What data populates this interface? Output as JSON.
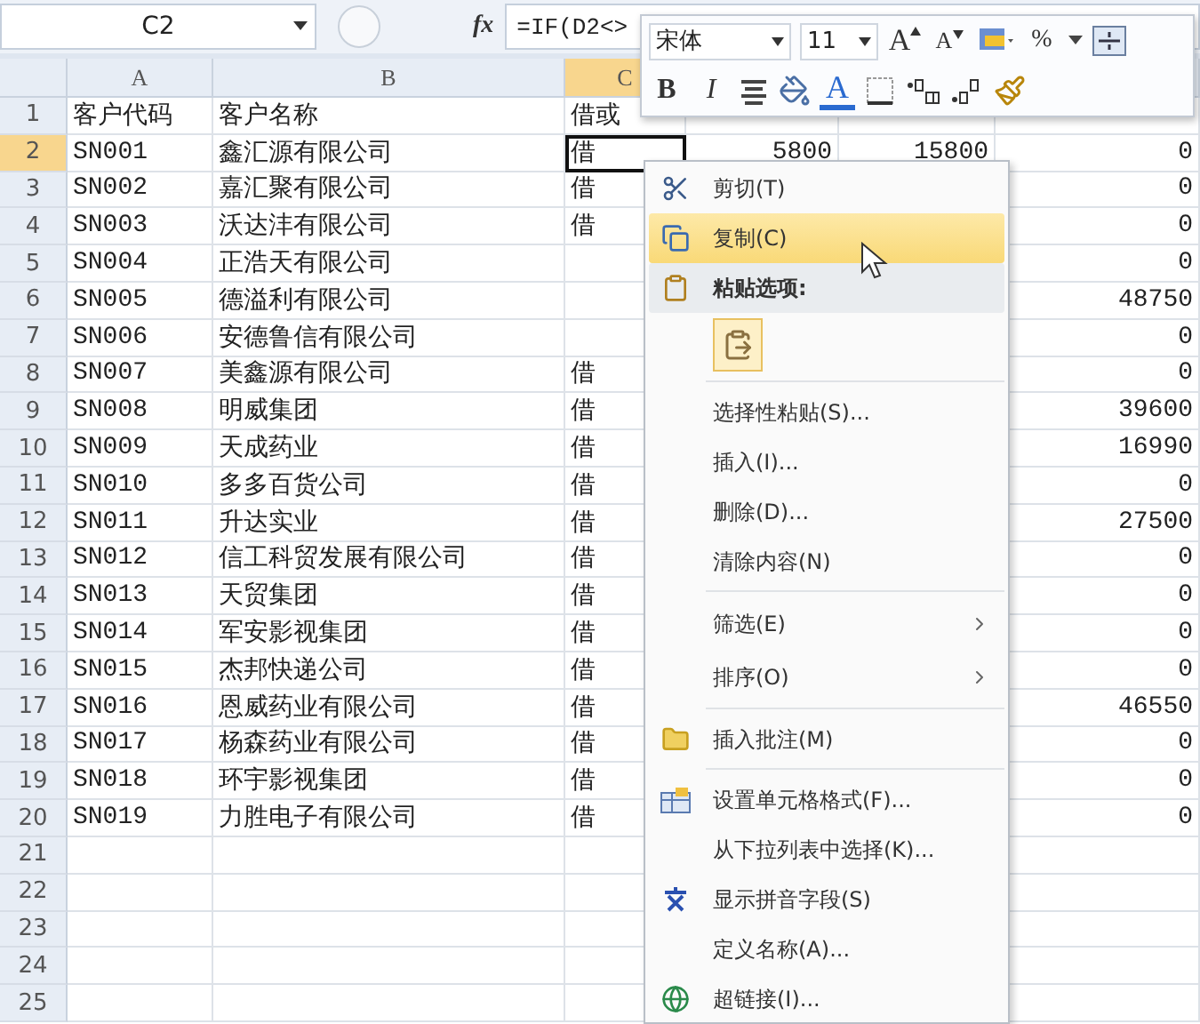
{
  "formula_bar": {
    "name_box": "C2",
    "function_label": "fx",
    "formula": "=IF(D2<>"
  },
  "mini_toolbar": {
    "rows": [
      [
        {
          "kind": "font",
          "value": "宋体"
        },
        {
          "kind": "size",
          "value": "11"
        },
        {
          "kind": "grow",
          "label": "A"
        },
        {
          "kind": "shrink",
          "label": "A"
        },
        {
          "kind": "style"
        },
        {
          "kind": "percent",
          "label": "%"
        },
        {
          "kind": "more"
        },
        {
          "kind": "merge"
        }
      ],
      [
        {
          "kind": "bold",
          "label": "B"
        },
        {
          "kind": "italic",
          "label": "I"
        },
        {
          "kind": "align"
        },
        {
          "kind": "fill"
        },
        {
          "kind": "fontcolor",
          "label": "A"
        },
        {
          "kind": "border"
        },
        {
          "kind": "incdec"
        },
        {
          "kind": "decdec"
        },
        {
          "kind": "painter"
        }
      ]
    ]
  },
  "sheet": {
    "columns": [
      {
        "label": "A",
        "selected": false
      },
      {
        "label": "B",
        "selected": false
      },
      {
        "label": "C",
        "selected": true
      }
    ],
    "rows": [
      {
        "number": "1",
        "selected": false,
        "A": "客户代码",
        "B": "客户名称",
        "C": "借或"
      },
      {
        "number": "2",
        "selected": true,
        "A": "SN001",
        "B": "鑫汇源有限公司",
        "C": "借",
        "D": "5800",
        "E": "15800",
        "F": "0"
      },
      {
        "number": "3",
        "selected": false,
        "A": "SN002",
        "B": "嘉汇聚有限公司",
        "C": "借",
        "F": "0"
      },
      {
        "number": "4",
        "selected": false,
        "A": "SN003",
        "B": "沃达沣有限公司",
        "C": "借",
        "F": "0"
      },
      {
        "number": "5",
        "selected": false,
        "A": "SN004",
        "B": "正浩天有限公司",
        "F": "0"
      },
      {
        "number": "6",
        "selected": false,
        "A": "SN005",
        "B": "德溢利有限公司",
        "F": "48750"
      },
      {
        "number": "7",
        "selected": false,
        "A": "SN006",
        "B": "安德鲁信有限公司",
        "F": "0"
      },
      {
        "number": "8",
        "selected": false,
        "A": "SN007",
        "B": "美鑫源有限公司",
        "C": "借",
        "F": "0"
      },
      {
        "number": "9",
        "selected": false,
        "A": "SN008",
        "B": "明威集团",
        "C": "借",
        "F": "39600"
      },
      {
        "number": "10",
        "selected": false,
        "A": "SN009",
        "B": "天成药业",
        "C": "借",
        "F": "16990"
      },
      {
        "number": "11",
        "selected": false,
        "A": "SN010",
        "B": "多多百货公司",
        "C": "借",
        "F": "0"
      },
      {
        "number": "12",
        "selected": false,
        "A": "SN011",
        "B": "升达实业",
        "C": "借",
        "F": "27500"
      },
      {
        "number": "13",
        "selected": false,
        "A": "SN012",
        "B": "信工科贸发展有限公司",
        "C": "借",
        "F": "0"
      },
      {
        "number": "14",
        "selected": false,
        "A": "SN013",
        "B": "天贸集团",
        "C": "借",
        "F": "0"
      },
      {
        "number": "15",
        "selected": false,
        "A": "SN014",
        "B": "军安影视集团",
        "C": "借",
        "F": "0"
      },
      {
        "number": "16",
        "selected": false,
        "A": "SN015",
        "B": "杰邦快递公司",
        "C": "借",
        "F": "0"
      },
      {
        "number": "17",
        "selected": false,
        "A": "SN016",
        "B": "恩威药业有限公司",
        "C": "借",
        "F": "46550"
      },
      {
        "number": "18",
        "selected": false,
        "A": "SN017",
        "B": "杨森药业有限公司",
        "C": "借",
        "F": "0"
      },
      {
        "number": "19",
        "selected": false,
        "A": "SN018",
        "B": "环宇影视集团",
        "C": "借",
        "F": "0"
      },
      {
        "number": "20",
        "selected": false,
        "A": "SN019",
        "B": "力胜电子有限公司",
        "C": "借",
        "F": "0"
      },
      {
        "number": "21",
        "selected": false
      },
      {
        "number": "22",
        "selected": false
      },
      {
        "number": "23",
        "selected": false
      },
      {
        "number": "24",
        "selected": false
      },
      {
        "number": "25",
        "selected": false
      }
    ]
  },
  "context_menu": {
    "items": [
      {
        "kind": "cut",
        "label": "剪切(T)",
        "selected": false
      },
      {
        "kind": "copy",
        "label": "复制(C)",
        "selected": true
      },
      {
        "kind": "paste-header",
        "label": "粘贴选项:",
        "selected": false
      },
      {
        "kind": "paste-button",
        "selected": false
      },
      {
        "kind": "separator"
      },
      {
        "kind": "plain",
        "label": "选择性粘贴(S)...",
        "selected": false
      },
      {
        "kind": "plain",
        "label": "插入(I)...",
        "selected": false
      },
      {
        "kind": "plain",
        "label": "删除(D)...",
        "selected": false
      },
      {
        "kind": "plain",
        "label": "清除内容(N)",
        "selected": false
      },
      {
        "kind": "separator"
      },
      {
        "kind": "submenu",
        "label": "筛选(E)",
        "selected": false
      },
      {
        "kind": "submenu",
        "label": "排序(O)",
        "selected": false
      },
      {
        "kind": "separator"
      },
      {
        "kind": "comment",
        "label": "插入批注(M)",
        "selected": false
      },
      {
        "kind": "separator"
      },
      {
        "kind": "format",
        "label": "设置单元格格式(F)...",
        "selected": false
      },
      {
        "kind": "plain",
        "label": "从下拉列表中选择(K)...",
        "selected": false
      },
      {
        "kind": "phonetic",
        "label": "显示拼音字段(S)",
        "selected": false
      },
      {
        "kind": "plain",
        "label": "定义名称(A)...",
        "selected": false
      },
      {
        "kind": "link",
        "label": "超链接(I)...",
        "selected": false
      }
    ]
  }
}
